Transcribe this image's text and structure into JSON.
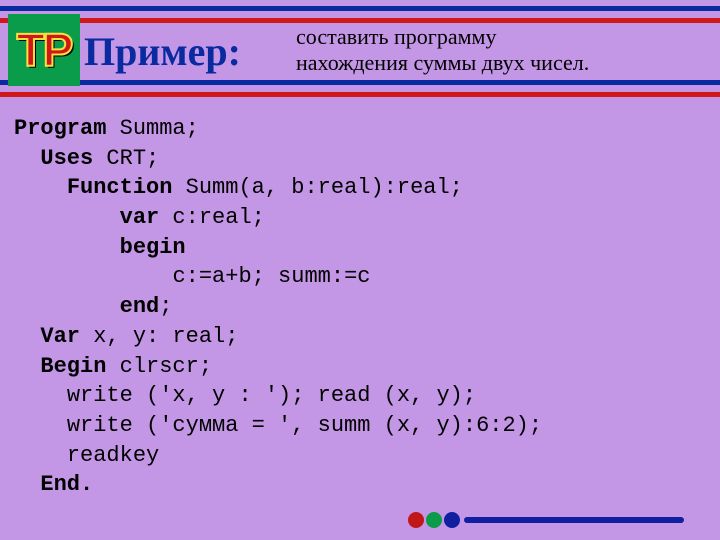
{
  "badge": "TP",
  "title": "Пример:",
  "subtitle_line1": "составить программу",
  "subtitle_line2": "нахождения суммы двух чисел.",
  "code": {
    "l1_kw": "Program",
    "l1_rest": " Summa;",
    "l2_kw": "Uses",
    "l2_rest": " CRT;",
    "l3_kw": "Function",
    "l3_rest": " Summ(a, b:real):real;",
    "l4_kw": "var",
    "l4_rest": " c:real;",
    "l5_kw": "begin",
    "l6": "c:=a+b; summ:=c",
    "l7_kw": "end",
    "l7_rest": ";",
    "l8_kw": "Var",
    "l8_rest": " x, y: real;",
    "l9_kw": "Begin",
    "l9_rest": " clrscr;",
    "l10": "write ('x, y : '); read (x, y);",
    "l11": "write ('сумма = ', summ (x, y):6:2);",
    "l12": "readkey",
    "l13_kw": "End."
  }
}
